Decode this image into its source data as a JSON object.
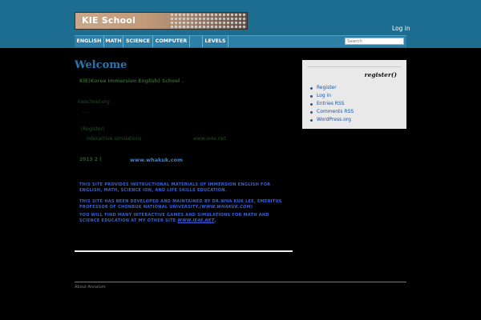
{
  "header": {
    "logo_text": "KIE School",
    "login_link": "Log in",
    "search_placeholder": "Search"
  },
  "nav": {
    "items": [
      "ENGLISH",
      "MATH",
      "SCIENCE",
      "COMPUTER",
      "",
      "LEVELS"
    ]
  },
  "main": {
    "title": "Welcome",
    "intro_title": "KIE(Korea Immersion English) School    .",
    "site_url_label": "kieschool.org",
    "dash_line": "-      -",
    "register_line": "(Register)",
    "interactive_line": "Interactive simulations",
    "ie4_line": "www.ie4e.net",
    "year_line": "2013 2      (",
    "whakuk_link": "www.whakuk.com",
    "caps_paragraph_1": "This site provides instructional materials of immersion English for English, Math, Science ion, and Life skills education.",
    "caps_paragraph_2_prefix": "This site has been developed and maintained by Dr.Wha Kuk Lee, Emeritus Professor of Chonbuk National University.",
    "caps_paragraph_2_link": "(www.whakuk.com)",
    "caps_paragraph_3_prefix": "You will find many interactive games and simulations for Math and Science Education at my other site",
    "caps_paragraph_3_link": "www.ie4e.net",
    "caps_paragraph_3_suffix": "."
  },
  "sidebar": {
    "title": "register()",
    "items": [
      "Register",
      "Log in",
      "Entries RSS",
      "Comments RSS",
      "WordPress.org"
    ]
  },
  "footer": {
    "text": "About Annalum"
  },
  "colors": {
    "top_bar": "#1d6d91",
    "nav_bar": "#2c7fa6",
    "title_blue": "#2a77b0",
    "caps_blue": "#3661d6",
    "sidebar_bg": "#e9e9e9"
  }
}
